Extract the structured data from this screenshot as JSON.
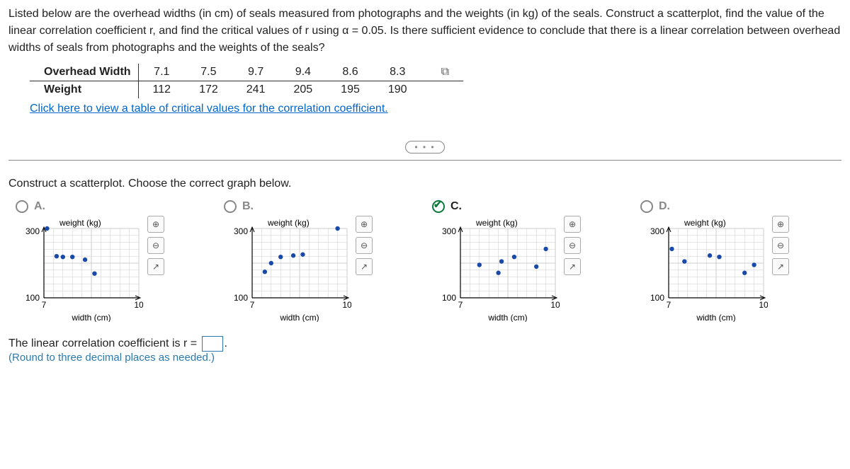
{
  "question": {
    "intro": "Listed below are the overhead widths (in cm) of seals measured from photographs and the weights (in kg) of the seals. Construct a scatterplot, find the value of the linear correlation coefficient r, and find the critical values of r using α = 0.05. Is there sufficient evidence to conclude that there is a linear correlation between overhead widths of seals from photographs and the weights of the seals?",
    "table": {
      "row1_label": "Overhead Width",
      "row2_label": "Weight",
      "widths": [
        "7.1",
        "7.5",
        "9.7",
        "9.4",
        "8.6",
        "8.3"
      ],
      "weights": [
        "112",
        "172",
        "241",
        "205",
        "195",
        "190"
      ]
    },
    "link_text": "Click here to view a table of critical values for the correlation coefficient.",
    "sub1": "Construct a scatterplot. Choose the correct graph below.",
    "options": [
      "A.",
      "B.",
      "C.",
      "D."
    ],
    "selected": "C.",
    "answer_prefix": "The linear correlation coefficient is r =",
    "answer_suffix": ".",
    "hint": "(Round to three decimal places as needed.)"
  },
  "chart_data": [
    {
      "type": "scatter",
      "option": "A",
      "xlabel": "width (cm)",
      "ylabel": "weight (kg)",
      "xlim": [
        7,
        10
      ],
      "ylim": [
        100,
        300
      ],
      "xticks": [
        7,
        10
      ],
      "yticks": [
        100,
        300
      ],
      "points": [
        [
          7.1,
          300
        ],
        [
          7.4,
          220
        ],
        [
          7.6,
          218
        ],
        [
          7.9,
          218
        ],
        [
          8.3,
          210
        ],
        [
          8.6,
          170
        ]
      ]
    },
    {
      "type": "scatter",
      "option": "B",
      "xlabel": "width (cm)",
      "ylabel": "weight (kg)",
      "xlim": [
        7,
        10
      ],
      "ylim": [
        100,
        300
      ],
      "xticks": [
        7,
        10
      ],
      "yticks": [
        100,
        300
      ],
      "points": [
        [
          7.4,
          175
        ],
        [
          7.6,
          200
        ],
        [
          7.9,
          218
        ],
        [
          8.3,
          222
        ],
        [
          8.6,
          225
        ],
        [
          9.7,
          300
        ]
      ]
    },
    {
      "type": "scatter",
      "option": "C",
      "xlabel": "width (cm)",
      "ylabel": "weight (kg)",
      "xlim": [
        7,
        10
      ],
      "ylim": [
        100,
        300
      ],
      "xticks": [
        7,
        10
      ],
      "yticks": [
        100,
        300
      ],
      "points": [
        [
          7.6,
          195
        ],
        [
          8.2,
          172
        ],
        [
          8.3,
          205
        ],
        [
          8.7,
          218
        ],
        [
          9.4,
          190
        ],
        [
          9.7,
          241
        ]
      ]
    },
    {
      "type": "scatter",
      "option": "D",
      "xlabel": "width (cm)",
      "ylabel": "weight (kg)",
      "xlim": [
        7,
        10
      ],
      "ylim": [
        100,
        300
      ],
      "xticks": [
        7,
        10
      ],
      "yticks": [
        100,
        300
      ],
      "points": [
        [
          7.1,
          241
        ],
        [
          7.5,
          205
        ],
        [
          8.3,
          222
        ],
        [
          8.6,
          218
        ],
        [
          9.4,
          172
        ],
        [
          9.7,
          195
        ]
      ]
    }
  ]
}
